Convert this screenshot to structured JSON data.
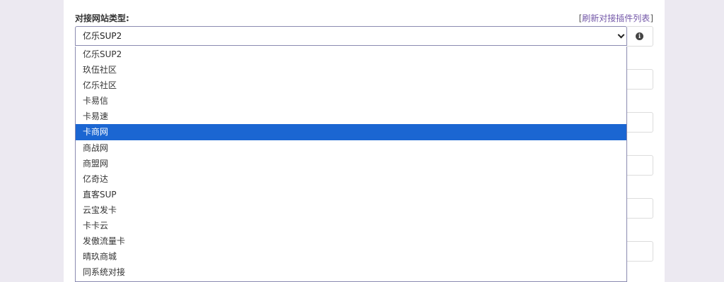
{
  "form": {
    "field_label": "对接网站类型:",
    "refresh_open": "[",
    "refresh_text": "刷新对接插件列表",
    "refresh_close": "]",
    "select_value": "亿乐SUP2",
    "info_glyph": "i"
  },
  "dropdown": {
    "selected_index": 5,
    "options": [
      "亿乐SUP2",
      "玖伍社区",
      "亿乐社区",
      "卡易信",
      "卡易速",
      "卡商网",
      "商战网",
      "商盟网",
      "亿奇达",
      "直客SUP",
      "云宝发卡",
      "卡卡云",
      "发傲流量卡",
      "晴玖商城",
      "同系统对接"
    ]
  },
  "colors": {
    "page_bg": "#ece9f1",
    "selected_bg": "#1b66d2",
    "link": "#7357a8"
  }
}
